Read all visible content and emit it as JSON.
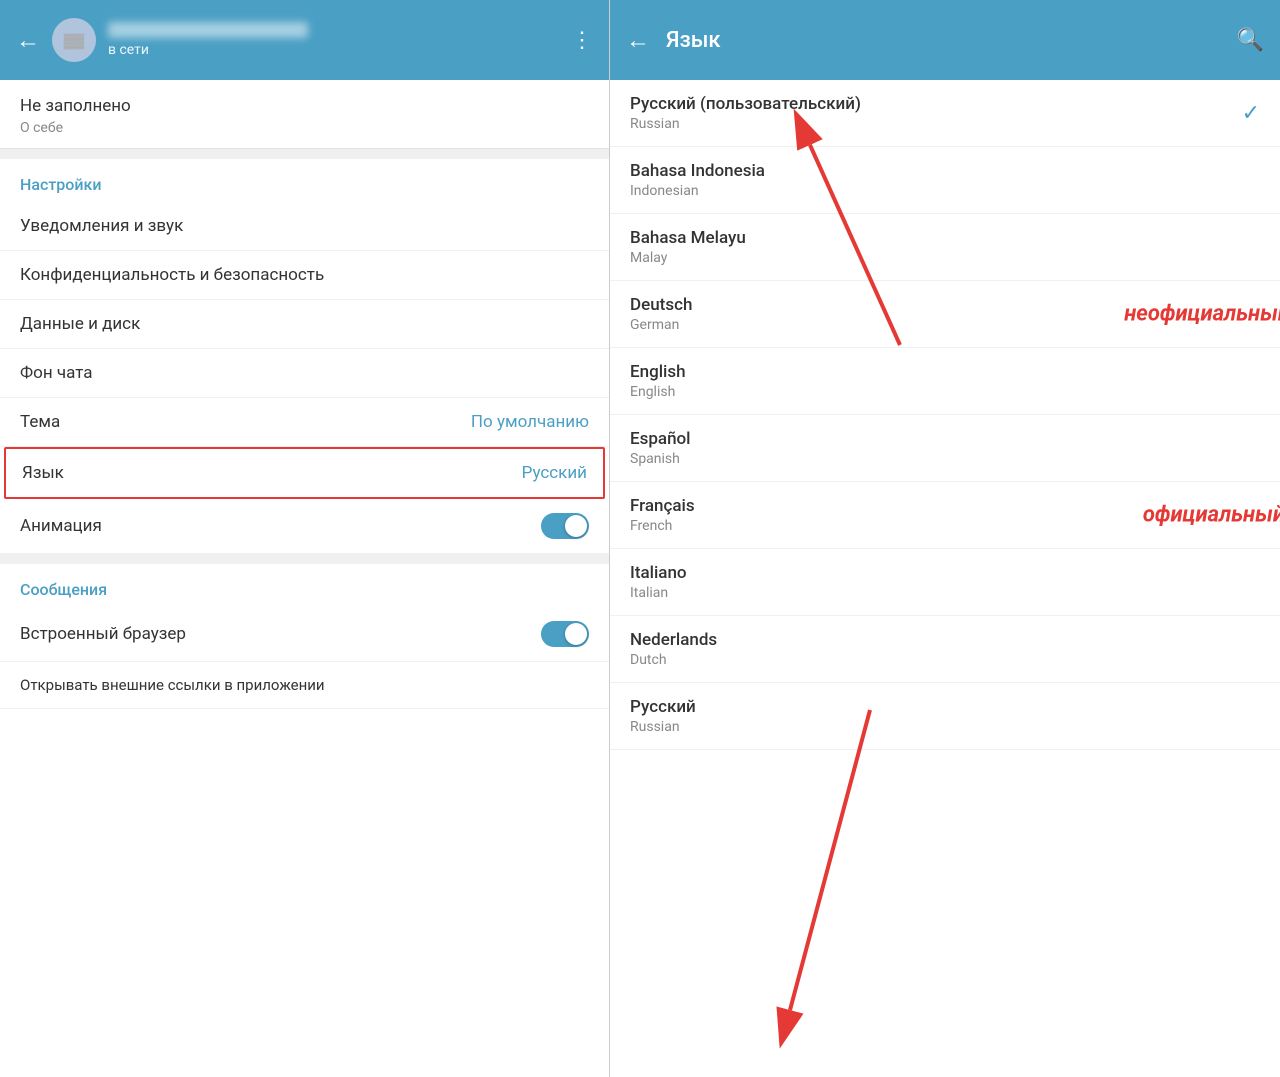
{
  "left": {
    "header": {
      "back_label": "←",
      "status": "в сети",
      "dots": "⋮"
    },
    "profile": {
      "not_filled": "Не заполнено",
      "about": "О себе"
    },
    "settings_header": "Настройки",
    "settings_items": [
      {
        "label": "Уведомления и звук",
        "value": ""
      },
      {
        "label": "Конфиденциальность и безопасность",
        "value": ""
      },
      {
        "label": "Данные и диск",
        "value": ""
      },
      {
        "label": "Фон чата",
        "value": ""
      },
      {
        "label": "Тема",
        "value": "По умолчанию"
      },
      {
        "label": "Язык",
        "value": "Русский",
        "highlighted": true
      },
      {
        "label": "Анимация",
        "value": "toggle"
      }
    ],
    "messages_header": "Сообщения",
    "messages_items": [
      {
        "label": "Встроенный браузер",
        "value": "toggle"
      },
      {
        "label": "Открывать внешние ссылки в приложении",
        "value": ""
      }
    ]
  },
  "right": {
    "header": {
      "back_label": "←",
      "title": "Язык"
    },
    "languages": [
      {
        "name": "Русский (пользовательский)",
        "sub": "Russian",
        "checked": true
      },
      {
        "name": "Bahasa Indonesia",
        "sub": "Indonesian",
        "checked": false
      },
      {
        "name": "Bahasa Melayu",
        "sub": "Malay",
        "checked": false
      },
      {
        "name": "Deutsch",
        "sub": "German",
        "checked": false,
        "annotation": "неофициальный"
      },
      {
        "name": "English",
        "sub": "English",
        "checked": false
      },
      {
        "name": "Español",
        "sub": "Spanish",
        "checked": false
      },
      {
        "name": "Français",
        "sub": "French",
        "checked": false,
        "annotation": "официальный"
      },
      {
        "name": "Italiano",
        "sub": "Italian",
        "checked": false
      },
      {
        "name": "Nederlands",
        "sub": "Dutch",
        "checked": false
      },
      {
        "name": "Русский",
        "sub": "Russian",
        "checked": false
      }
    ]
  }
}
